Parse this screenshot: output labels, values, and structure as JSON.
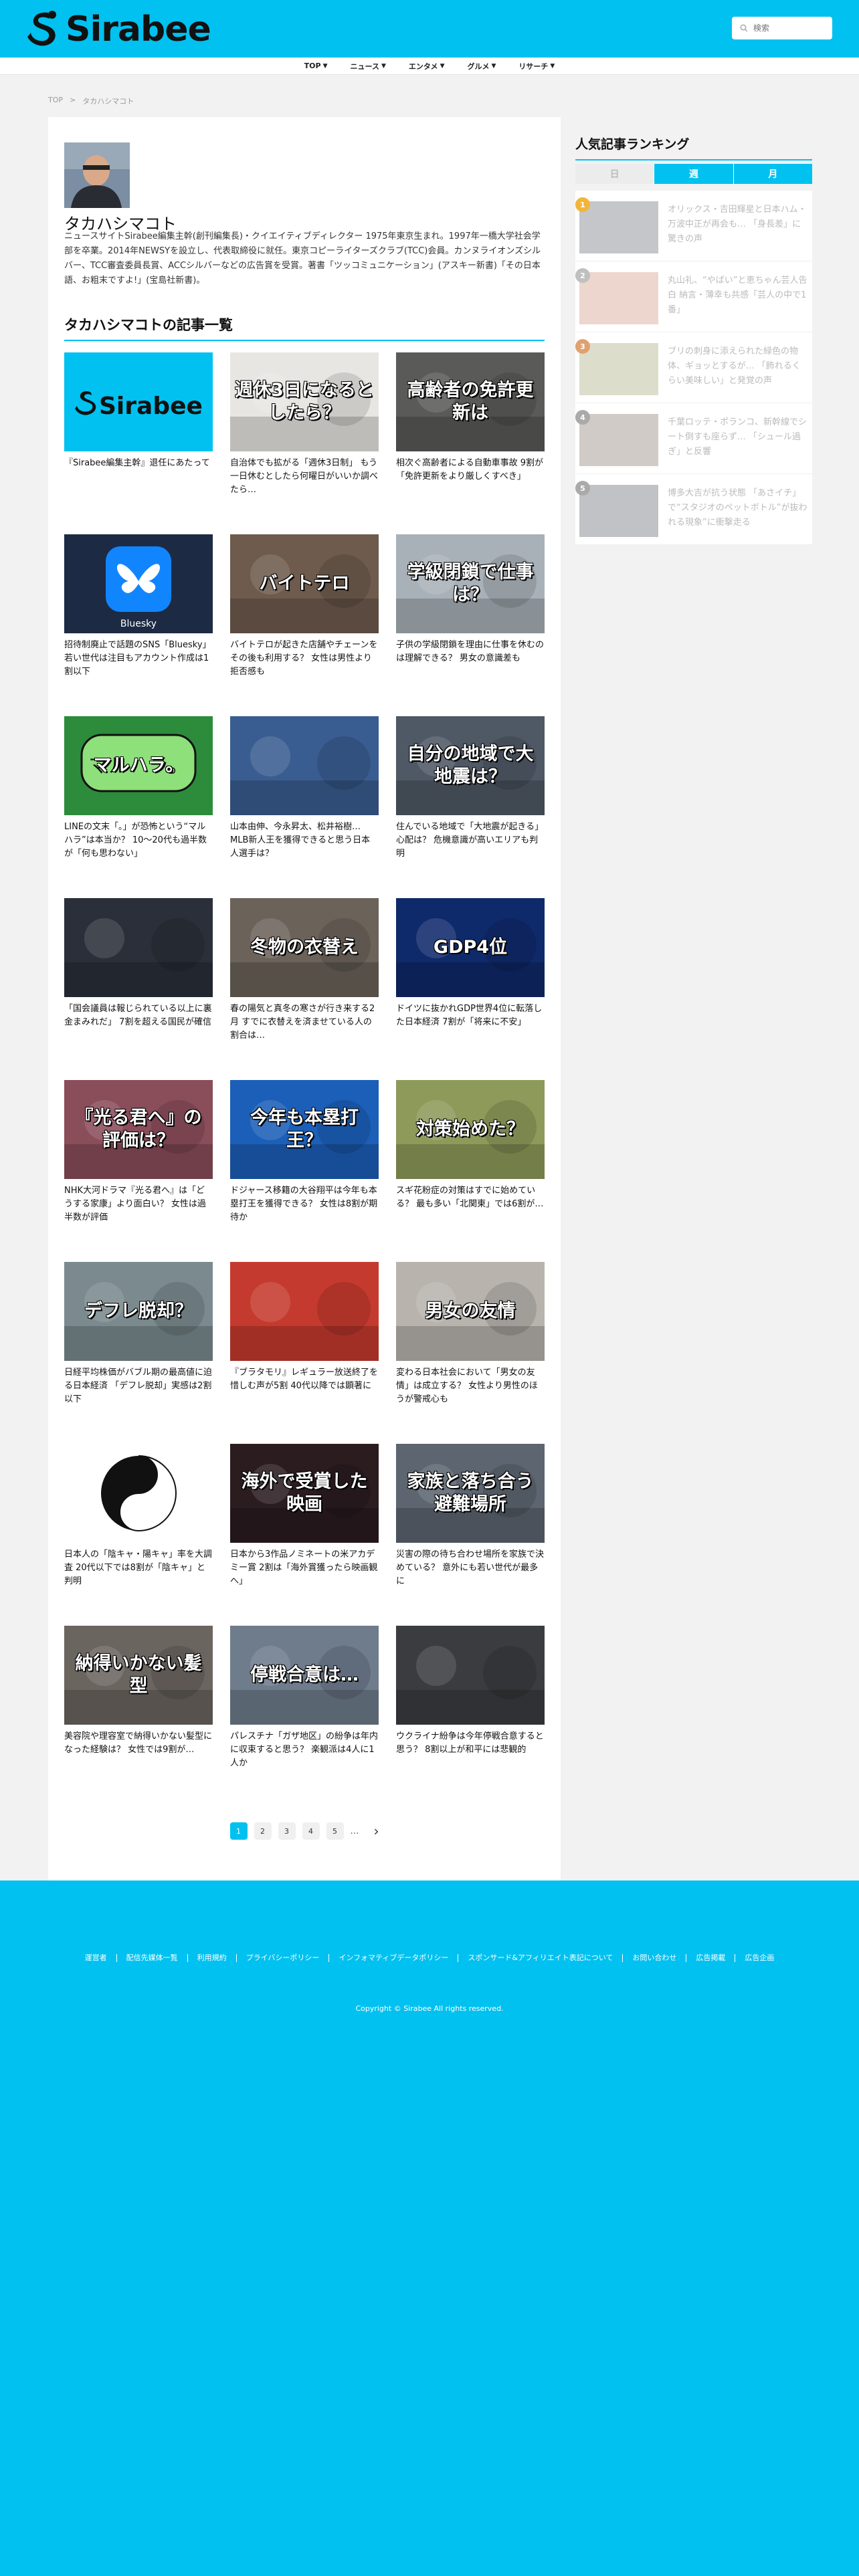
{
  "header": {
    "logo_text": "Sirabee",
    "search_placeholder": "検索"
  },
  "nav": {
    "items": [
      "TOP",
      "ニュース",
      "エンタメ",
      "グルメ",
      "リサーチ"
    ]
  },
  "breadcrumb": {
    "home": "TOP",
    "separator": ">",
    "current": "タカハシマコト"
  },
  "profile": {
    "name": "タカハシマコト",
    "bio": "ニュースサイトSirabee編集主幹(創刊編集長)・クイエイティブディレクター 1975年東京生まれ。1997年一橋大学社会学部を卒業。2014年NEWSYを設立し、代表取締役に就任。東京コピーライターズクラブ(TCC)会員。カンヌライオンズシルバー、TCC審査委員長賞、ACCシルバーなどの広告賞を受賞。著書「ツッコミュニケーション」(アスキー新書)「その日本語、お粗末ですよ!」(宝島社新書)。"
  },
  "articles": {
    "section_title": "タカハシマコトの記事一覧",
    "items": [
      {
        "title": "『Sirabee編集主幹』退任にあたって",
        "overlay": "",
        "bg": "#00c1f0"
      },
      {
        "title": "自治体でも拡がる「週休3日制」 もう一日休むとしたら何曜日がいいか調べたら…",
        "overlay": "週休3日になるとしたら？",
        "bg": "#e8e6e2"
      },
      {
        "title": "相次ぐ高齢者による自動車事故 9割が「免許更新をより厳しくすべき」",
        "overlay": "高齢者の免許更新は",
        "bg": "#5a5a58"
      },
      {
        "title": "招待制廃止で話題のSNS「Bluesky」 若い世代は注目もアカウント作成は1割以下",
        "overlay": "",
        "bg": "#1d2a44"
      },
      {
        "title": "バイトテロが起きた店舗やチェーンをその後も利用する？ 女性は男性より拒否感も",
        "overlay": "バイトテロ",
        "bg": "#6e5b4d"
      },
      {
        "title": "子供の学級閉鎖を理由に仕事を休むのは理解できる？ 男女の意識差も",
        "overlay": "学級閉鎖で仕事は？",
        "bg": "#a9b1b8"
      },
      {
        "title": "LINEの文末「。」が恐怖という“マルハラ”は本当か？ 10〜20代も過半数が「何も思わない」",
        "overlay": "マルハラ。",
        "bg": "#2d8b3c"
      },
      {
        "title": "山本由伸、今永昇太、松井裕樹… MLB新人王を獲得できると思う日本人選手は？",
        "overlay": "",
        "bg": "#3a5d91"
      },
      {
        "title": "住んでいる地域で「大地震が起きる」心配は？ 危機意識が高いエリアも判明",
        "overlay": "自分の地域で大地震は？",
        "bg": "#4f5865"
      },
      {
        "title": "「国会議員は報じられている以上に裏金まみれだ」 7割を超える国民が確信",
        "overlay": "",
        "bg": "#2a2f3a"
      },
      {
        "title": "春の陽気と真冬の寒さが行き来する2月 すでに衣替えを済ませている人の割合は…",
        "overlay": "冬物の衣替え",
        "bg": "#6b625a"
      },
      {
        "title": "ドイツに抜かれGDP世界4位に転落した日本経済 7割が「将来に不安」",
        "overlay": "GDP4位",
        "bg": "#0f2a6b"
      },
      {
        "title": "NHK大河ドラマ『光る君へ』は「どうする家康」より面白い？ 女性は過半数が評価",
        "overlay": "『光る君へ』の評価は？",
        "bg": "#8a4d5a"
      },
      {
        "title": "ドジャース移籍の大谷翔平は今年も本塁打王を獲得できる？ 女性は8割が期待か",
        "overlay": "今年も本塁打王？",
        "bg": "#1b5fb8"
      },
      {
        "title": "スギ花粉症の対策はすでに始めている？ 最も多い「北関東」では6割が…",
        "overlay": "対策始めた？",
        "bg": "#8e9a5a"
      },
      {
        "title": "日経平均株価がバブル期の最高値に迫る日本経済 「デフレ脱却」実感は2割以下",
        "overlay": "デフレ脱却？",
        "bg": "#7b8a8e"
      },
      {
        "title": "『ブラタモリ』レギュラー放送終了を惜しむ声が5割 40代以降では顕著に",
        "overlay": "",
        "bg": "#c53a2e"
      },
      {
        "title": "変わる日本社会において「男女の友情」は成立する？ 女性より男性のほうが警戒心も",
        "overlay": "男女の友情",
        "bg": "#b8b3ad"
      },
      {
        "title": "日本人の「陰キャ・陽キャ」率を大調査 20代以下では8割が「陰キャ」と判明",
        "overlay": "",
        "bg": "#ffffff"
      },
      {
        "title": "日本から3作品ノミネートの米アカデミー賞 2割は「海外賞獲ったら映画観へ」",
        "overlay": "海外で受賞した映画",
        "bg": "#2b1c20"
      },
      {
        "title": "災害の際の待ち合わせ場所を家族で決めている？ 意外にも若い世代が最多に",
        "overlay": "家族と落ち合う避難場所",
        "bg": "#5c6570"
      },
      {
        "title": "美容院や理容室で納得いかない髪型になった経験は？ 女性では9割が…",
        "overlay": "納得いかない髪型",
        "bg": "#6b6560"
      },
      {
        "title": "パレスチナ「ガザ地区」の紛争は年内に収束すると思う？ 楽観派は4人に1人か",
        "overlay": "停戦合意は…",
        "bg": "#6e7c8c"
      },
      {
        "title": "ウクライナ紛争は今年停戦合意すると思う？ 8割以上が和平には悲観的",
        "overlay": "",
        "bg": "#3a3c40"
      }
    ]
  },
  "pagination": {
    "pages": [
      "1",
      "2",
      "3",
      "4",
      "5"
    ],
    "ellipsis": "…",
    "next": "›"
  },
  "sidebar": {
    "title": "人気記事ランキング",
    "tabs": [
      "日",
      "週",
      "月"
    ],
    "ranking": [
      {
        "num": "1",
        "title": "オリックス・吉田輝星と日本ハム・万波中正が再会も… 「身長差」に驚きの声",
        "badge": "#f2b53a",
        "bg": "#555d66"
      },
      {
        "title": "丸山礼、“やばい”と恵ちゃん芸人告白 納言・薄幸も共感「芸人の中で1番」",
        "num": "2",
        "badge": "#c0c0c0",
        "bg": "#c98a70"
      },
      {
        "num": "3",
        "title": "ブリの刺身に添えられた緑色の物体、ギョッとするが… 「飾れるくらい美味しい」と発覚の声",
        "badge": "#e0a070",
        "bg": "#9aa06a"
      },
      {
        "num": "4",
        "title": "千葉ロッテ・ポランコ、新幹線でシート倒すも座らず… 「シュール過ぎ」と反響",
        "badge": "#aaaaaa",
        "bg": "#7a6b60"
      },
      {
        "num": "5",
        "title": "博多大吉が抗う状態 「あさイチ」で“スタジオのペットボトル”が抜われる現象”に衝撃走る",
        "badge": "#aaaaaa",
        "bg": "#4e5158"
      }
    ]
  },
  "footer": {
    "links": [
      "運営者",
      "配信先媒体一覧",
      "利用規約",
      "プライバシーポリシー",
      "インフォマティブデータポリシー",
      "スポンサード&アフィリエイト表記について",
      "お問い合わせ",
      "広告掲載",
      "広告企画"
    ],
    "copyright": "Copyright © Sirabee All rights reserved."
  },
  "colors": {
    "brand": "#00c1f0",
    "page_bg": "#f2f2f2"
  }
}
